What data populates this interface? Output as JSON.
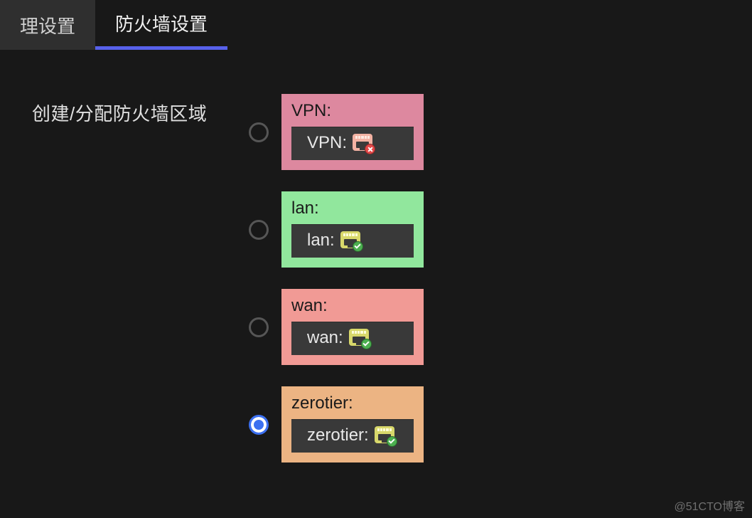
{
  "tabs": {
    "inactive_partial": "理设置",
    "active": "防火墙设置"
  },
  "section_label": "创建/分配防火墙区域",
  "zones": [
    {
      "id": "vpn",
      "title": "VPN:",
      "inner_label": "VPN:",
      "color_class": "zone-card-pink",
      "icon_class": "port-icon-pink",
      "status": "err",
      "selected": false
    },
    {
      "id": "lan",
      "title": "lan:",
      "inner_label": "lan:",
      "color_class": "zone-card-green",
      "icon_class": "",
      "status": "ok",
      "selected": false
    },
    {
      "id": "wan",
      "title": "wan:",
      "inner_label": "wan:",
      "color_class": "zone-card-lightred",
      "icon_class": "",
      "status": "ok",
      "selected": false
    },
    {
      "id": "zerotier",
      "title": "zerotier:",
      "inner_label": "zerotier:",
      "color_class": "zone-card-orange",
      "icon_class": "",
      "status": "ok",
      "selected": true
    }
  ],
  "watermark": "@51CTO博客"
}
